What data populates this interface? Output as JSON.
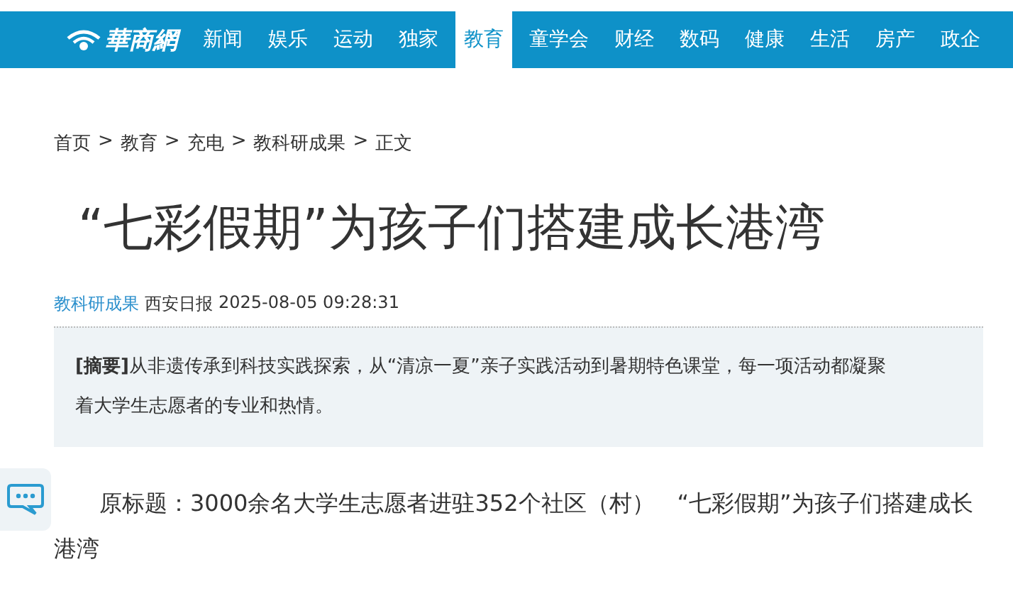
{
  "logo": {
    "text": "華商網"
  },
  "nav": [
    {
      "label": "新闻",
      "selected": false
    },
    {
      "label": "娱乐",
      "selected": false
    },
    {
      "label": "运动",
      "selected": false
    },
    {
      "label": "独家",
      "selected": false
    },
    {
      "label": "教育",
      "selected": true
    },
    {
      "label": "童学会",
      "selected": false
    },
    {
      "label": "财经",
      "selected": false
    },
    {
      "label": "数码",
      "selected": false
    },
    {
      "label": "健康",
      "selected": false
    },
    {
      "label": "生活",
      "selected": false
    },
    {
      "label": "房产",
      "selected": false
    },
    {
      "label": "政企",
      "selected": false
    }
  ],
  "breadcrumb": {
    "items": [
      "首页",
      "教育",
      "充电",
      "教科研成果",
      "正文"
    ],
    "separator": ">"
  },
  "article": {
    "title": "“七彩假期”为孩子们搭建成长港湾",
    "category": "教科研成果",
    "source": "西安日报",
    "datetime": "2025-08-05 09:28:31",
    "summary": "**[摘要]**从非遗传承到科技实践探索，从“清凉一夏”亲子实践活动到暑期特色课堂，每一项活动都凝聚着大学生志愿者的专业和热情。",
    "paragraphs": [
      "原标题：3000余名大学生志愿者进驻352个社区（村）　“七彩假期”为孩子们搭建成长港湾"
    ]
  }
}
